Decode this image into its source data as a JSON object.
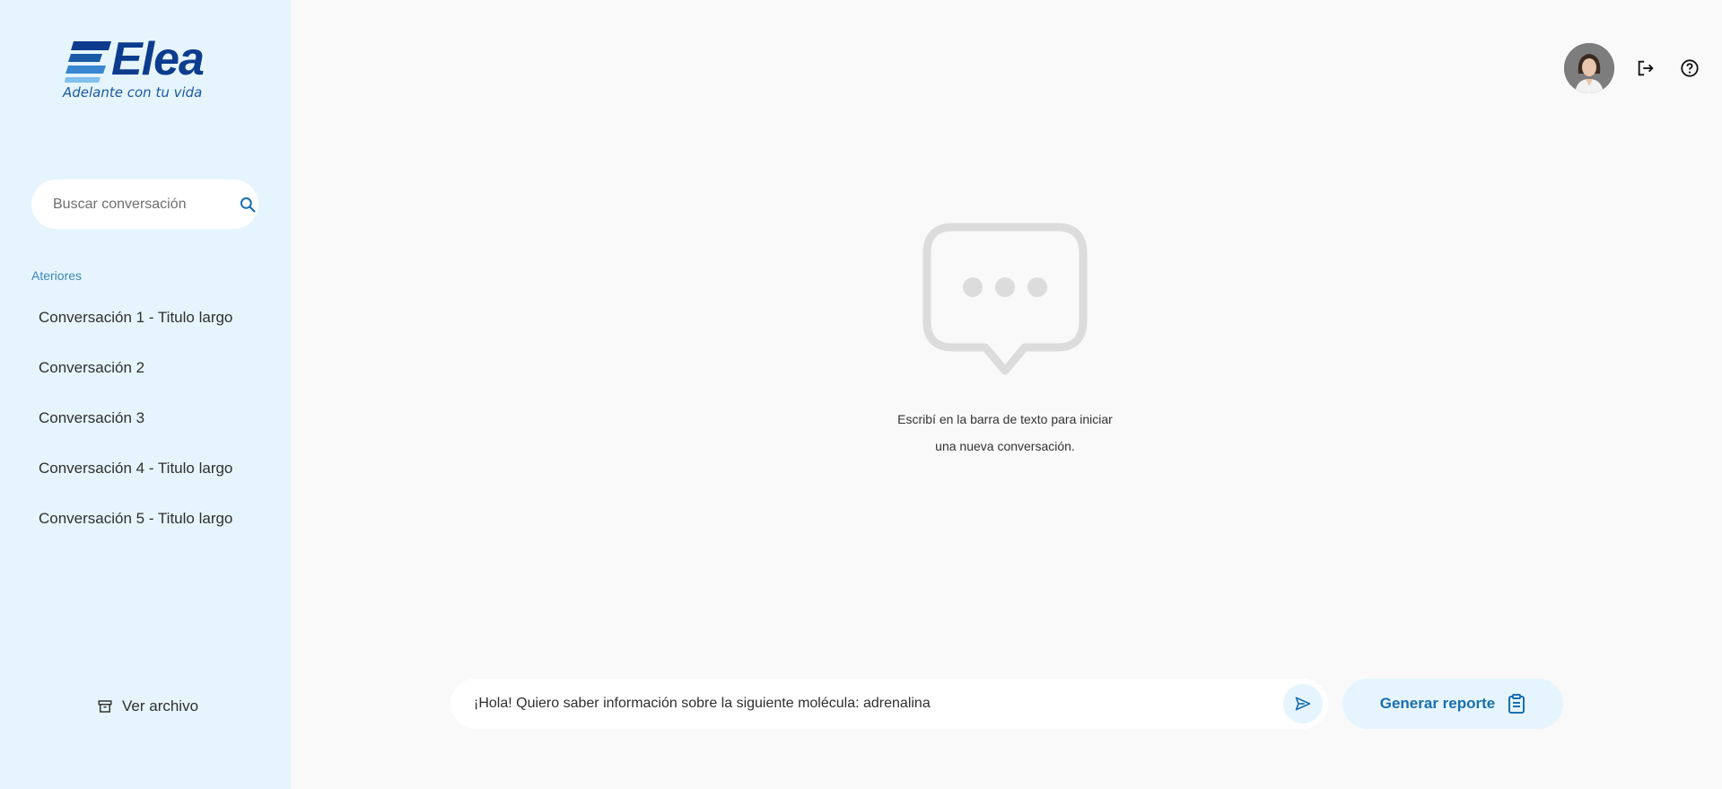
{
  "brand": {
    "logo_text": "Elea",
    "tagline": "Adelante con tu vida",
    "primary_color": "#0d3c8e",
    "accent_color": "#1a6fb0",
    "sidebar_bg": "#e6f5fd"
  },
  "sidebar": {
    "search_placeholder": "Buscar conversación",
    "section_label": "Ateriores",
    "conversations": [
      "Conversación 1 - Titulo largo",
      "Conversación 2",
      "Conversación 3",
      "Conversación 4 - Titulo largo",
      "Conversación 5 - Titulo largo"
    ],
    "archive_label": "Ver archivo"
  },
  "header": {
    "icons": [
      "avatar",
      "logout-icon",
      "help-icon"
    ]
  },
  "empty_state": {
    "icon": "chat-bubble-dots-icon",
    "line1": "Escribí en la barra de texto para iniciar",
    "line2": "una nueva conversación."
  },
  "composer": {
    "value": "¡Hola! Quiero saber información sobre la siguiente molécula: adrenalina",
    "send_icon": "send-icon"
  },
  "report_button": {
    "label": "Generar reporte",
    "icon": "clipboard-icon"
  }
}
